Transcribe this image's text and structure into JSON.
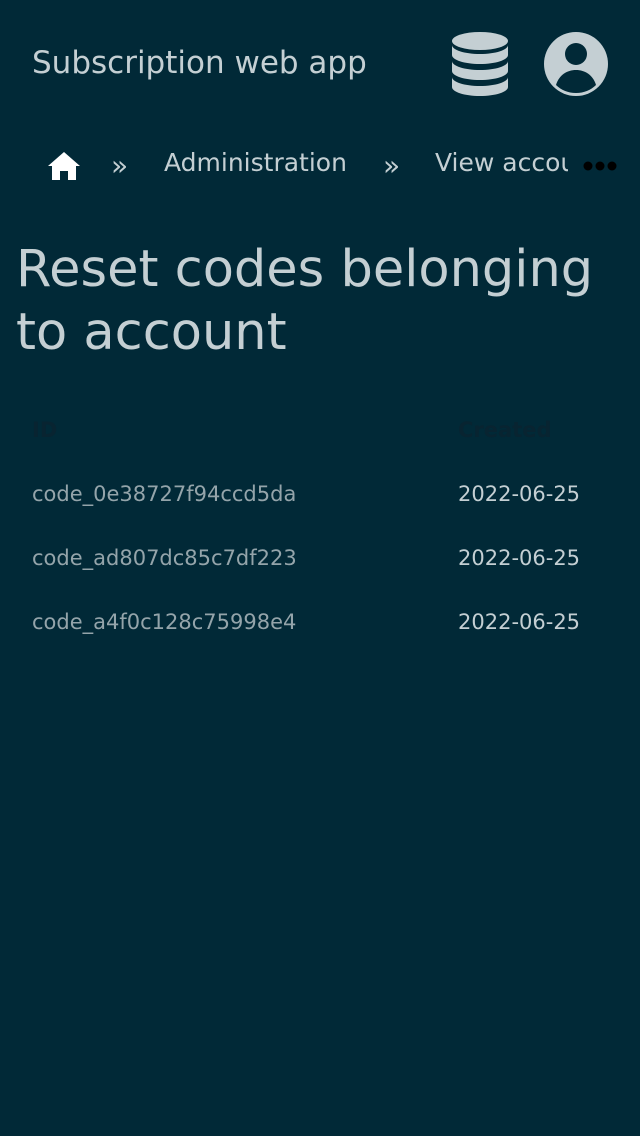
{
  "header": {
    "app_title": "Subscription web app",
    "database_icon": "database-icon",
    "user_icon": "user-circle-icon"
  },
  "breadcrumb": {
    "home_icon": "home-icon",
    "separator": "»",
    "items": [
      {
        "label": "Administration"
      },
      {
        "label": "View account"
      }
    ],
    "more_icon": "ellipsis-icon"
  },
  "page": {
    "title": "Reset codes belonging to account"
  },
  "table": {
    "columns": [
      "ID",
      "Created"
    ],
    "rows": [
      {
        "id": "code_0e38727f94ccd5da",
        "created": "2022-06-25"
      },
      {
        "id": "code_ad807dc85c7df223",
        "created": "2022-06-25"
      },
      {
        "id": "code_a4f0c128c75998e4",
        "created": "2022-06-25"
      }
    ]
  },
  "colors": {
    "background": "#012937",
    "text": "#c4cfd3",
    "muted_text": "#94a4aa",
    "header_text": "#082431",
    "icon_fill": "#c4cfd3"
  }
}
